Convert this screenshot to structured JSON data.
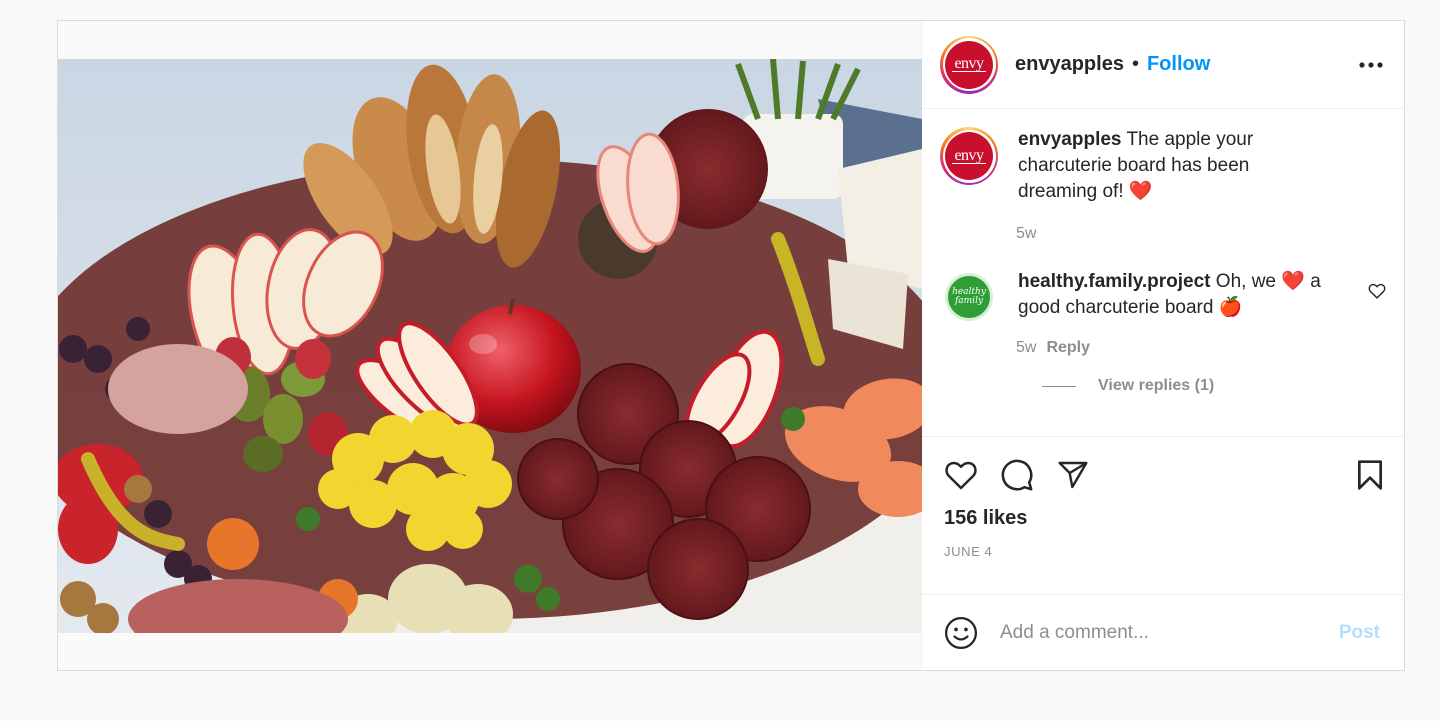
{
  "post": {
    "image_alt": "charcuterie board with apples, bread, salami, cauliflower and cheese",
    "author": {
      "username": "envyapples",
      "avatar_text": "envy",
      "separator": "•",
      "follow_label": "Follow"
    },
    "caption": {
      "username": "envyapples",
      "text": "The apple your charcuterie board has been dreaming of!",
      "emoji": "❤️",
      "age": "5w"
    },
    "comments": [
      {
        "username": "healthy.family.project",
        "text_before": "Oh, we",
        "emoji1": "❤️",
        "text_after": "a good charcuterie board",
        "emoji2": "🍎",
        "age": "5w",
        "reply_label": "Reply",
        "avatar_line1": "healthy",
        "avatar_line2": "family",
        "view_replies": "View replies (1)"
      }
    ],
    "likes": "156 likes",
    "date": "JUNE 4",
    "add_comment": {
      "placeholder": "Add a comment...",
      "post_label": "Post"
    }
  },
  "icons": {
    "more": "more-horizontal-icon",
    "like": "heart-icon",
    "comment": "comment-bubble-icon",
    "share": "paper-plane-icon",
    "save": "bookmark-icon",
    "emoji": "smiley-icon",
    "comment_like": "heart-small-icon"
  },
  "colors": {
    "follow": "#0095f6",
    "post_disabled": "#b2dffc",
    "muted": "#8e8e8e",
    "brand_envy": "#c8102e"
  }
}
